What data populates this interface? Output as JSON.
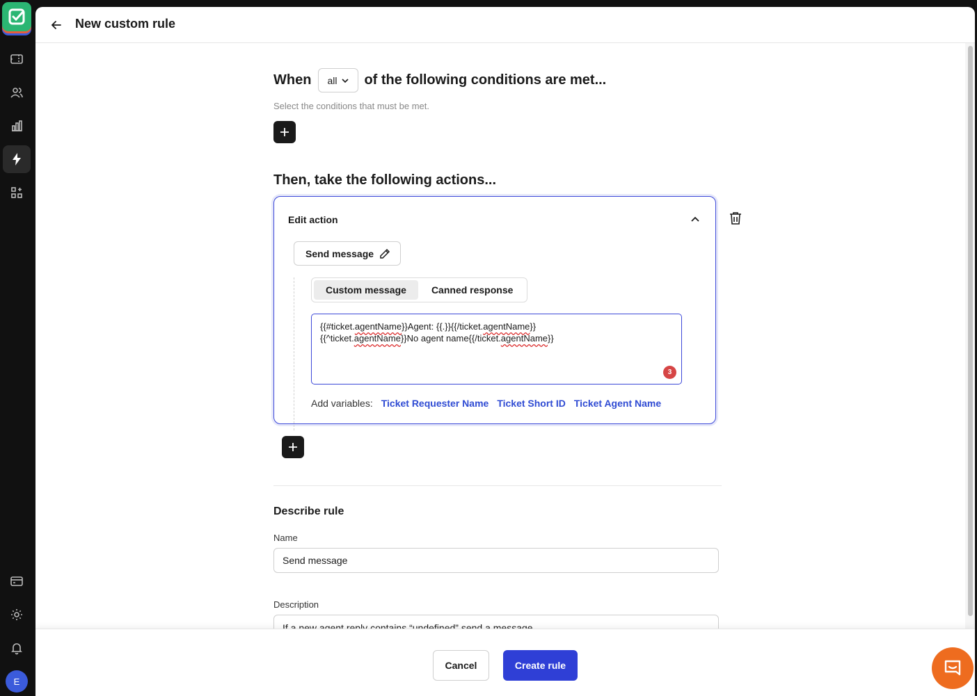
{
  "app": {
    "avatar_initial": "E"
  },
  "header": {
    "title": "New custom rule"
  },
  "conditions": {
    "prefix": "When",
    "match_select": "all",
    "suffix": "of the following conditions are met...",
    "hint": "Select the conditions that must be met."
  },
  "actions": {
    "heading": "Then, take the following actions...",
    "card_title": "Edit action",
    "action_button": "Send message",
    "tabs": [
      "Custom message",
      "Canned response"
    ],
    "message_lines": [
      [
        "{{#ticket.",
        "agentName",
        "}}Agent: {{.}}{{/ticket.",
        "agentName",
        "}}"
      ],
      [
        "{{^ticket.",
        "agentName",
        "}}No agent name{{/ticket.",
        "agentName",
        "}}"
      ]
    ],
    "error_count": "3",
    "variables_label": "Add variables:",
    "variables": [
      "Ticket Requester Name",
      "Ticket Short ID",
      "Ticket Agent Name"
    ]
  },
  "describe": {
    "heading": "Describe rule",
    "name_label": "Name",
    "name_value": "Send message",
    "description_label": "Description",
    "description_value": "If a new agent reply contains “undefined” send a message"
  },
  "footer": {
    "cancel": "Cancel",
    "create": "Create rule"
  },
  "colors": {
    "accent": "#2f3fd6",
    "brand": "#2bb673",
    "chat": "#ee6c1f",
    "error": "#d64545"
  }
}
